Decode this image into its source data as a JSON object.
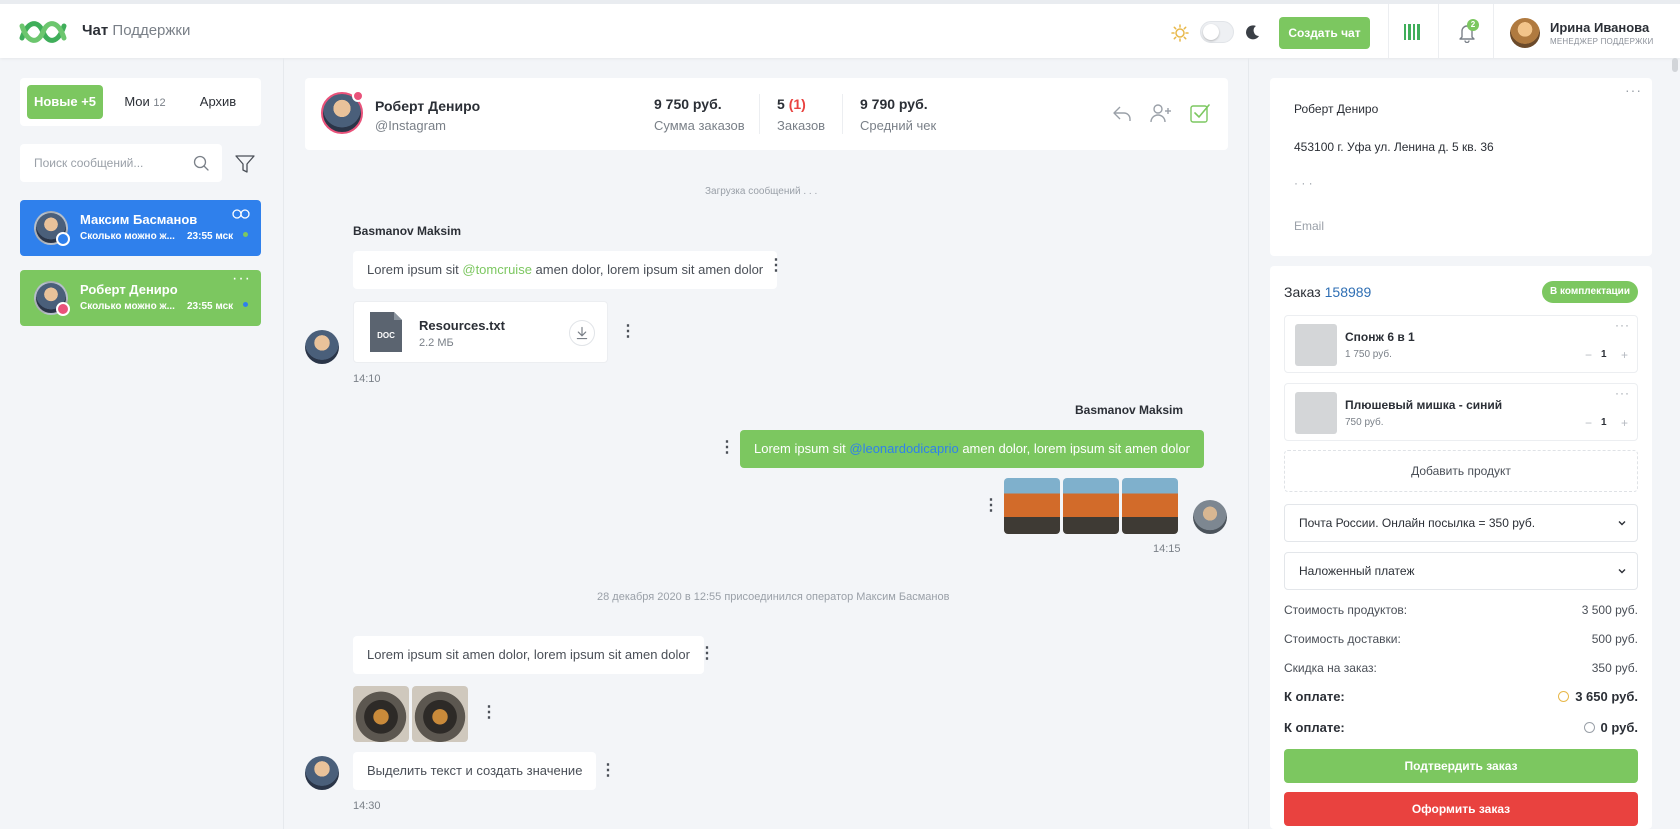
{
  "header": {
    "brand_bold": "Чат",
    "brand_rest": "Поддержки",
    "create_chat_label": "Создать чат",
    "notifications_count": "2",
    "user_name": "Ирина Иванова",
    "user_role": "МЕНЕДЖЕР ПОДДЕРЖКИ"
  },
  "sidebar": {
    "tabs": [
      {
        "label": "Новые",
        "count": "+5"
      },
      {
        "label": "Мои",
        "count": "12"
      },
      {
        "label": "Архив",
        "count": ""
      }
    ],
    "search_placeholder": "Поиск сообщений...",
    "chats": [
      {
        "name": "Максим Басманов",
        "preview": "Сколько можно ж...",
        "time": "23:55 мск",
        "status_color": "#7cc760",
        "channel": "telegram"
      },
      {
        "name": "Роберт Дениро",
        "preview": "Сколько можно ж...",
        "time": "23:55 мск",
        "status_color": "#2f80ec",
        "channel": "instagram"
      }
    ]
  },
  "client": {
    "name": "Роберт Дениро",
    "source": "@Instagram",
    "stats": [
      {
        "value": "9 750 руб.",
        "label": "Сумма заказов"
      },
      {
        "value": "5",
        "value_extra": "(1)",
        "label": "Заказов"
      },
      {
        "value": "9 790 руб.",
        "label": "Средний чек"
      }
    ]
  },
  "chat": {
    "loading_text": "Загрузка сообщений . . .",
    "messages": [
      {
        "sender": "Basmanov Maksim",
        "text_before": "Lorem ipsum sit ",
        "mention": "@tomcruise",
        "text_after": " amen dolor, lorem ipsum sit amen dolor"
      },
      {
        "file_name": "Resources.txt",
        "file_size": "2.2 МБ",
        "file_type": "DOC",
        "time": "14:10"
      },
      {
        "sender": "Basmanov Maksim",
        "text_before": "Lorem ipsum sit ",
        "mention": "@leonardodicaprio",
        "text_after": " amen dolor, lorem ipsum sit amen dolor",
        "time": "14:15"
      },
      {
        "system": "28 декабря 2020 в 12:55 присоединился оператор Максим Басманов"
      },
      {
        "text": "Lorem ipsum sit amen dolor, lorem ipsum sit amen dolor"
      },
      {
        "text": "Выделить текст и создать значение",
        "time": "14:30"
      }
    ]
  },
  "client_info": {
    "name": "Роберт Дениро",
    "address": "453100 г. Уфа ул. Ленина д. 5 кв. 36",
    "phone_hint": "· · ·",
    "email_placeholder": "Email"
  },
  "order": {
    "title": "Заказ",
    "number": "158989",
    "status": "В комплектации",
    "products": [
      {
        "name": "Спонж 6 в 1",
        "price": "1 750 руб.",
        "qty": "1"
      },
      {
        "name": "Плюшевый мишка - синий",
        "price": "750 руб.",
        "qty": "1"
      }
    ],
    "add_product_label": "Добавить продукт",
    "delivery": "Почта России. Онлайн посылка = 350 руб.",
    "payment": "Наложенный платеж",
    "summary": [
      {
        "label": "Стоимость продуктов:",
        "value": "3 500 руб."
      },
      {
        "label": "Стоимость доставки:",
        "value": "500 руб."
      },
      {
        "label": "Скидка на заказ:",
        "value": "350 руб."
      }
    ],
    "totals": [
      {
        "label": "К оплате:",
        "value": "3 650 руб."
      },
      {
        "label": "К оплате:",
        "value": "0 руб."
      }
    ],
    "confirm_label": "Подтвердить заказ",
    "checkout_label": "Оформить заказ"
  },
  "colors": {
    "accent_green": "#7cc760",
    "accent_blue": "#2f80ec",
    "danger_red": "#e9423f"
  }
}
